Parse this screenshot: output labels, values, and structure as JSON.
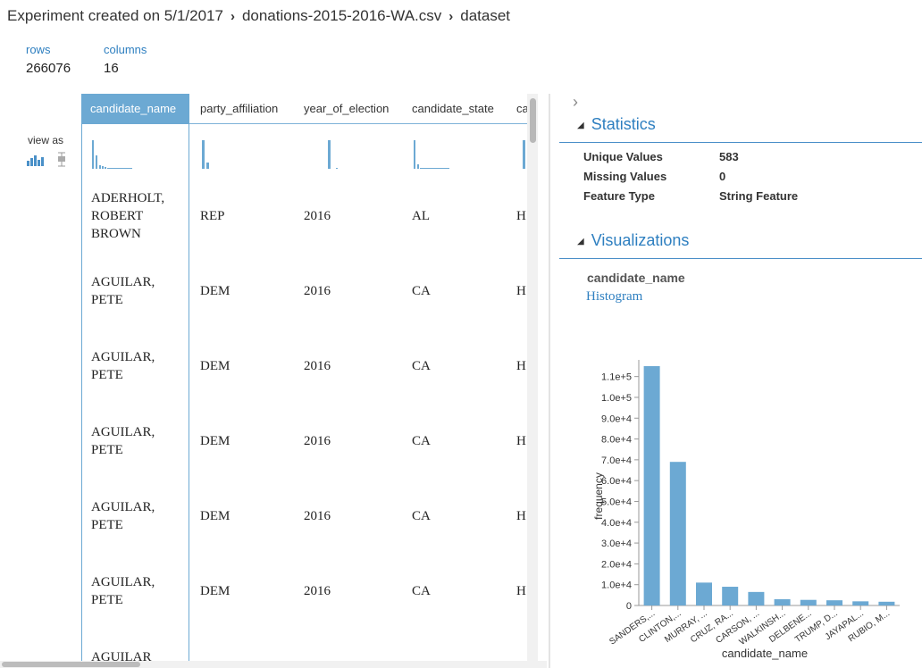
{
  "breadcrumb": {
    "items": [
      "Experiment created on 5/1/2017",
      "donations-2015-2016-WA.csv",
      "dataset"
    ],
    "separator": "›"
  },
  "summary": {
    "rows_label": "rows",
    "rows_value": "266076",
    "columns_label": "columns",
    "columns_value": "16"
  },
  "view_as_label": "view as",
  "table": {
    "columns": [
      "candidate_name",
      "party_affiliation",
      "year_of_election",
      "candidate_state",
      "ca"
    ],
    "rows": [
      [
        "ADERHOLT, ROBERT BROWN",
        "REP",
        "2016",
        "AL",
        "H"
      ],
      [
        "AGUILAR, PETE",
        "DEM",
        "2016",
        "CA",
        "H"
      ],
      [
        "AGUILAR, PETE",
        "DEM",
        "2016",
        "CA",
        "H"
      ],
      [
        "AGUILAR, PETE",
        "DEM",
        "2016",
        "CA",
        "H"
      ],
      [
        "AGUILAR, PETE",
        "DEM",
        "2016",
        "CA",
        "H"
      ],
      [
        "AGUILAR, PETE",
        "DEM",
        "2016",
        "CA",
        "H"
      ],
      [
        "AGUILAR",
        "",
        "",
        "",
        ""
      ]
    ]
  },
  "panel": {
    "statistics_title": "Statistics",
    "stats": [
      {
        "label": "Unique Values",
        "value": "583"
      },
      {
        "label": "Missing Values",
        "value": "0"
      },
      {
        "label": "Feature Type",
        "value": "String Feature"
      }
    ],
    "visualizations_title": "Visualizations",
    "column_name": "candidate_name",
    "viz_type": "Histogram"
  },
  "colors": {
    "accent": "#2e7fc0",
    "bar": "#6ca9d3",
    "selected_header": "#6ca9d3"
  },
  "chart_data": {
    "type": "bar",
    "xlabel": "candidate_name",
    "ylabel": "frequency",
    "categories": [
      "SANDERS,...",
      "CLINTON,...",
      "MURRAY, ...",
      "CRUZ, RA...",
      "CARSON, ...",
      "WALKINSH...",
      "DELBENE...",
      "TRUMP, D...",
      "JAYAPAL...",
      "RUBIO, M..."
    ],
    "values": [
      115000,
      69000,
      11000,
      9000,
      6500,
      3000,
      2700,
      2500,
      2000,
      1800
    ],
    "ylim": [
      0,
      118000
    ],
    "yticks": [
      0,
      10000,
      20000,
      30000,
      40000,
      50000,
      60000,
      70000,
      80000,
      90000,
      100000,
      110000
    ],
    "ytick_labels": [
      "0",
      "1.0e+4",
      "2.0e+4",
      "3.0e+4",
      "4.0e+4",
      "5.0e+4",
      "6.0e+4",
      "7.0e+4",
      "8.0e+4",
      "9.0e+4",
      "1.0e+5",
      "1.1e+5"
    ],
    "grid": false
  }
}
